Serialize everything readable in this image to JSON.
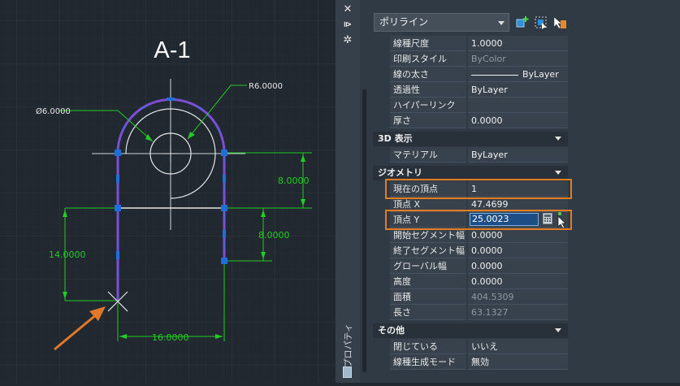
{
  "drawing": {
    "title": "A-1",
    "dims": {
      "radius": "R6.0000",
      "diameter": "Ø6.0000",
      "dim_right_upper": "8.0000",
      "dim_right_lower": "8.0000",
      "dim_left": "14.0000",
      "dim_bottom": "16.0000"
    },
    "colors": {
      "background": "#212830",
      "polyline": "#7a4fd6",
      "dimension": "#22cc22",
      "grips": "#1e6fd9",
      "arrow": "#e07a2a"
    }
  },
  "palette": {
    "strip_label": "プロパティ",
    "object_type": "ポリライン",
    "general_rows": [
      {
        "key": "線種尺度",
        "value": "1.0000",
        "dim": false
      },
      {
        "key": "印刷スタイル",
        "value": "ByColor",
        "dim": true
      },
      {
        "key": "線の太さ",
        "value": "ByLayer",
        "dim": false
      },
      {
        "key": "透過性",
        "value": "ByLayer",
        "dim": false
      },
      {
        "key": "ハイパーリンク",
        "value": "",
        "dim": false
      },
      {
        "key": "厚さ",
        "value": "0.0000",
        "dim": false
      }
    ],
    "section_3d": "3D 表示",
    "rows_3d": [
      {
        "key": "マテリアル",
        "value": "ByLayer",
        "dim": false
      }
    ],
    "section_geometry": "ジオメトリ",
    "geometry_rows": [
      {
        "key": "現在の頂点",
        "value": "1",
        "dim": false
      },
      {
        "key": "頂点 X",
        "value": "47.4699",
        "dim": false
      },
      {
        "key": "頂点 Y",
        "value": "25.0023",
        "dim": false
      },
      {
        "key": "開始セグメント幅",
        "value": "0.0000",
        "dim": false
      },
      {
        "key": "終了セグメント幅",
        "value": "0.0000",
        "dim": false
      },
      {
        "key": "グローバル幅",
        "value": "0.0000",
        "dim": false
      },
      {
        "key": "高度",
        "value": "0.0000",
        "dim": false
      },
      {
        "key": "面積",
        "value": "404.5309",
        "dim": true
      },
      {
        "key": "長さ",
        "value": "63.1327",
        "dim": true
      }
    ],
    "section_misc": "その他",
    "misc_rows": [
      {
        "key": "閉じている",
        "value": "いいえ",
        "dim": false
      },
      {
        "key": "線種生成モード",
        "value": "無効",
        "dim": false
      }
    ],
    "highlight_color": "#e47d22"
  }
}
